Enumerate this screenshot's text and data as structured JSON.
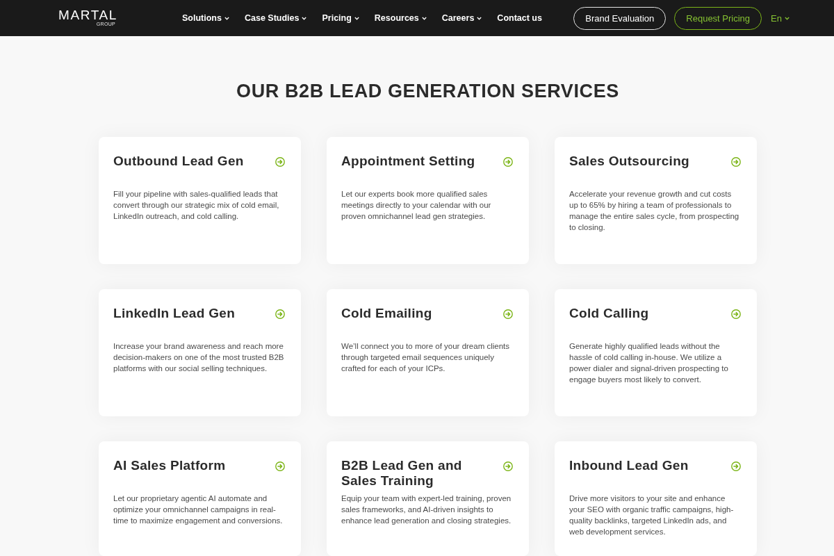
{
  "header": {
    "logo": {
      "wordmark": "MARTAL",
      "tagline": "GROUP"
    },
    "nav": [
      {
        "label": "Solutions",
        "dropdown": true
      },
      {
        "label": "Case Studies",
        "dropdown": true
      },
      {
        "label": "Pricing",
        "dropdown": true
      },
      {
        "label": "Resources",
        "dropdown": true
      },
      {
        "label": "Careers",
        "dropdown": true
      },
      {
        "label": "Contact us",
        "dropdown": false
      }
    ],
    "buttons": [
      {
        "label": "Brand Evaluation",
        "kind": "outline"
      },
      {
        "label": "Request Pricing",
        "kind": "accent"
      }
    ],
    "language": {
      "label": "En",
      "dropdown": true
    }
  },
  "section": {
    "title": "OUR B2B LEAD GENERATION SERVICES",
    "cards": [
      {
        "title": "Outbound Lead Gen",
        "description": "Fill your pipeline with sales-qualified leads that convert through our strategic mix of cold email, LinkedIn outreach, and cold calling."
      },
      {
        "title": "Appointment Setting",
        "description": "Let our experts book more qualified sales meetings directly to your calendar with our proven omnichannel lead gen strategies."
      },
      {
        "title": "Sales Outsourcing",
        "description": "Accelerate your revenue growth and cut costs up to 65% by hiring a team of professionals to manage the entire sales cycle, from prospecting to closing."
      },
      {
        "title": "LinkedIn Lead Gen",
        "description": "Increase your brand awareness and reach more decision-makers on one of the most trusted B2B platforms with our social selling techniques."
      },
      {
        "title": "Cold Emailing",
        "description": "We’ll connect you to more of your dream clients through targeted email sequences uniquely crafted for each of your ICPs."
      },
      {
        "title": "Cold Calling",
        "description": "Generate highly qualified leads without the hassle of cold calling in-house. We utilize a power dialer and signal-driven prospecting to engage buyers most likely to convert."
      },
      {
        "title": "AI Sales Platform",
        "description": "Let our proprietary agentic AI automate and optimize your omnichannel campaigns in real-time to maximize engagement and conversions."
      },
      {
        "title": "B2B Lead Gen and Sales Training",
        "description": "Equip your team with expert-led training, proven sales frameworks, and AI-driven insights to enhance lead generation and closing strategies."
      },
      {
        "title": "Inbound Lead Gen",
        "description": "Drive more visitors to your site and enhance your SEO with organic traffic campaigns, high-quality backlinks, targeted LinkedIn ads, and web development services."
      }
    ]
  }
}
